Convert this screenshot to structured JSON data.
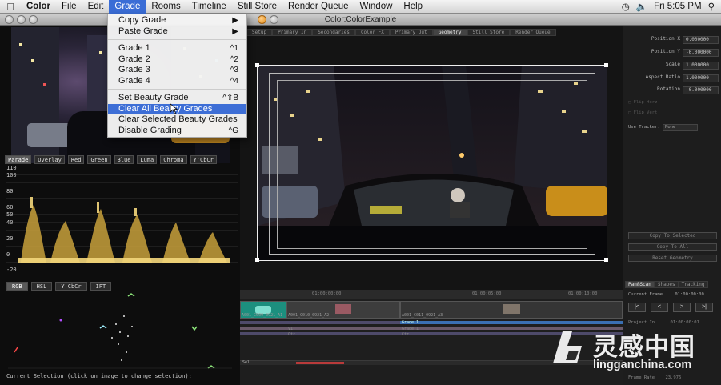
{
  "menubar": {
    "apple_icon": "apple-icon",
    "items": [
      "Color",
      "File",
      "Edit",
      "Grade",
      "Rooms",
      "Timeline",
      "Still Store",
      "Render Queue",
      "Window",
      "Help"
    ],
    "active": "Grade",
    "clock": "Fri 5:05 PM"
  },
  "window": {
    "title": "Color:ColorExample"
  },
  "grade_menu": {
    "items": [
      {
        "label": "Copy Grade",
        "shortcut": "▶"
      },
      {
        "label": "Paste Grade",
        "shortcut": "▶"
      },
      {
        "label": "Grade 1",
        "shortcut": "^1"
      },
      {
        "label": "Grade 2",
        "shortcut": "^2"
      },
      {
        "label": "Grade 3",
        "shortcut": "^3"
      },
      {
        "label": "Grade 4",
        "shortcut": "^4"
      },
      {
        "label": "Set Beauty Grade",
        "shortcut": "^⇧B"
      },
      {
        "label": "Clear All Beauty Grades",
        "shortcut": ""
      },
      {
        "label": "Clear Selected Beauty Grades",
        "shortcut": ""
      },
      {
        "label": "Disable Grading",
        "shortcut": "^G"
      }
    ],
    "highlighted": "Clear All Beauty Grades"
  },
  "room_tabs": [
    "Setup",
    "Primary In",
    "Secondaries",
    "Color FX",
    "Primary Out",
    "Geometry",
    "Still Store",
    "Render Queue"
  ],
  "selected_room": "Geometry",
  "scopes": {
    "waveform_tabs": [
      "Parade",
      "Overlay",
      "Red",
      "Green",
      "Blue",
      "Luma",
      "Chroma",
      "Y'CbCr"
    ],
    "selected_waveform": "Parade",
    "y_ticks": [
      "110",
      "100",
      "80",
      "60",
      "50",
      "40",
      "20",
      "0",
      "-20"
    ],
    "vector_tabs": [
      "RGB",
      "HSL",
      "Y'CbCr",
      "IPT"
    ],
    "current_selection": "Current Selection (click on image to change selection):"
  },
  "geometry": {
    "params": [
      {
        "label": "Position X",
        "value": "0.000000"
      },
      {
        "label": "Position Y",
        "value": "-0.000000"
      },
      {
        "label": "Scale",
        "value": "1.000000"
      },
      {
        "label": "Aspect Ratio",
        "value": "1.000000"
      },
      {
        "label": "Rotation",
        "value": "-0.000000"
      }
    ],
    "flip_h": "Flip Horz",
    "flip_v": "Flip Vert",
    "use_tracker_label": "Use Tracker",
    "use_tracker_value": "None",
    "buttons": [
      "Copy To Selected",
      "Copy To All",
      "Reset Geometry"
    ],
    "subtabs": [
      "Pan&Scan",
      "Shapes",
      "Tracking"
    ],
    "current_frame_label": "Current Frame",
    "current_frame_value": "01:00:00:00",
    "transport": [
      "|<",
      "<",
      ">",
      ">|"
    ],
    "project_in_label": "Project In",
    "project_in_value": "01:00:00:01",
    "frame_rate_label": "Frame Rate",
    "frame_rate_value": "23.976"
  },
  "timeline": {
    "ruler": [
      "01:00:00:00",
      "01:00:05:00",
      "01:00:10:00"
    ],
    "clips": [
      "A001_C009_0921_A1",
      "A001_C010_0921_A2",
      "A001_C011_0921_A3",
      "Grade 1"
    ],
    "tracks": [
      "V1",
      "Ctr",
      "Grade 1",
      "Ctr"
    ],
    "sequence_label": "Sel"
  },
  "watermark": {
    "cn": "灵感中国",
    "en": "lingganchina.com"
  }
}
